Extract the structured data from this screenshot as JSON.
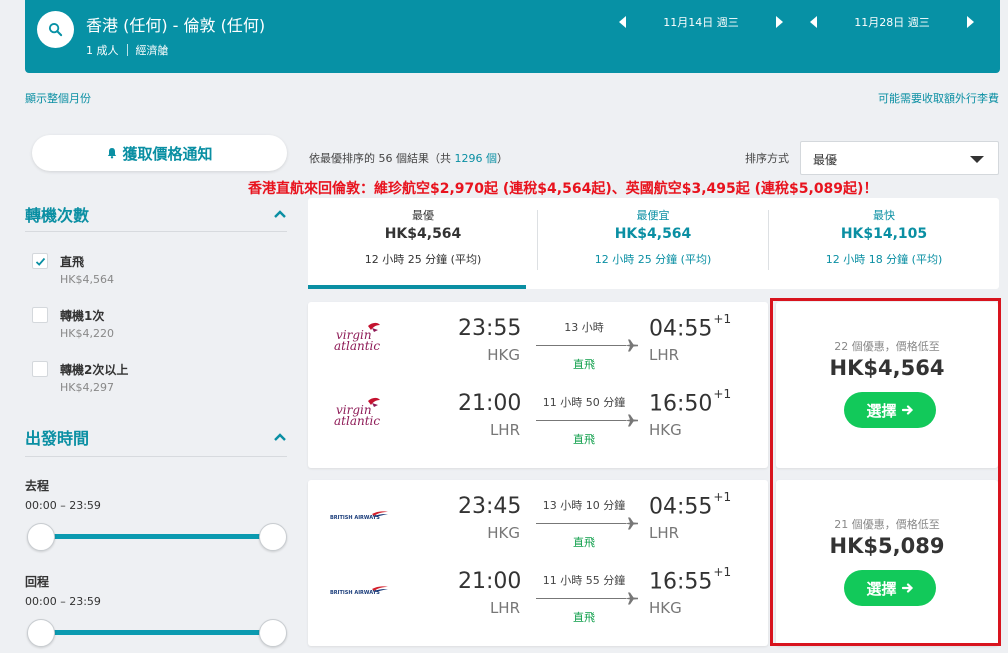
{
  "header": {
    "route": "香港 (任何) - 倫敦 (任何)",
    "passengers": "1 成人",
    "cabin": "經濟艙",
    "depart_date": "11月14日 週三",
    "return_date": "11月28日 週三"
  },
  "links": {
    "show_month": "顯示整個月份",
    "extra_fees": "可能需要收取額外行李費"
  },
  "sidebar": {
    "alert_label": "獲取價格通知",
    "stops_title": "轉機次數",
    "stops": [
      {
        "label": "直飛",
        "price": "HK$4,564",
        "checked": true
      },
      {
        "label": "轉機1次",
        "price": "HK$4,220",
        "checked": false
      },
      {
        "label": "轉機2次以上",
        "price": "HK$4,297",
        "checked": false
      }
    ],
    "times_title": "出發時間",
    "outbound_label": "去程",
    "outbound_range": "00:00 – 23:59",
    "return_label": "回程",
    "return_range": "00:00 – 23:59"
  },
  "results": {
    "count_prefix": "依最優排序的 56 個結果（共",
    "total": "1296 個",
    "count_suffix": "）",
    "sort_label": "排序方式",
    "sort_value": "最優",
    "promo": "香港直航來回倫敦：維珍航空$2,970起 (連稅$4,564起)、英國航空$3,495起 (連稅$5,089起)！"
  },
  "sort_tabs": [
    {
      "name": "最優",
      "price": "HK$4,564",
      "duration": "12 小時 25 分鐘 (平均)"
    },
    {
      "name": "最便宜",
      "price": "HK$4,564",
      "duration": "12 小時 25 分鐘 (平均)"
    },
    {
      "name": "最快",
      "price": "HK$14,105",
      "duration": "12 小時 18 分鐘 (平均)"
    }
  ],
  "flights": [
    {
      "airline": "virgin atlantic",
      "legs": [
        {
          "dep_time": "23:55",
          "dep_code": "HKG",
          "duration": "13 小時",
          "stops": "直飛",
          "arr_time": "04:55",
          "day_offset": "+1",
          "arr_code": "LHR"
        },
        {
          "dep_time": "21:00",
          "dep_code": "LHR",
          "duration": "11 小時 50 分鐘",
          "stops": "直飛",
          "arr_time": "16:50",
          "day_offset": "+1",
          "arr_code": "HKG"
        }
      ],
      "deals": "22 個優惠，價格低至",
      "price": "HK$4,564",
      "select_label": "選擇"
    },
    {
      "airline": "BRITISH AIRWAYS",
      "legs": [
        {
          "dep_time": "23:45",
          "dep_code": "HKG",
          "duration": "13 小時 10 分鐘",
          "stops": "直飛",
          "arr_time": "04:55",
          "day_offset": "+1",
          "arr_code": "LHR"
        },
        {
          "dep_time": "21:00",
          "dep_code": "LHR",
          "duration": "11 小時 55 分鐘",
          "stops": "直飛",
          "arr_time": "16:55",
          "day_offset": "+1",
          "arr_code": "HKG"
        }
      ],
      "deals": "21 個優惠，價格低至",
      "price": "HK$5,089",
      "select_label": "選擇"
    }
  ],
  "colors": {
    "header_bg": "#0791a5",
    "accent": "#0a8fa3",
    "select_green": "#12c95a",
    "promo_red": "#e8131e",
    "highlight_border": "#d8141e"
  }
}
